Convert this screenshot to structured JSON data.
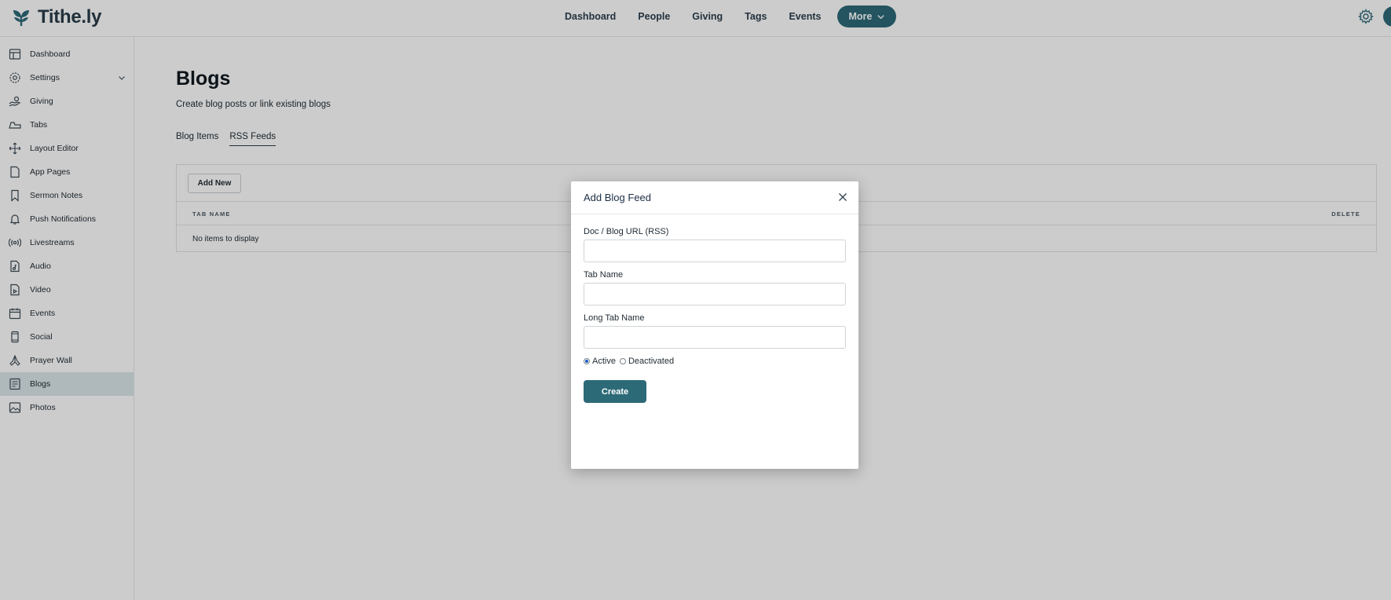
{
  "brand": {
    "name": "Tithe.ly",
    "accent": "#2d6a78"
  },
  "topnav": {
    "items": [
      "Dashboard",
      "People",
      "Giving",
      "Tags",
      "Events"
    ],
    "more_label": "More"
  },
  "sidebar": {
    "items": [
      {
        "label": "Dashboard",
        "icon": "dashboard-icon"
      },
      {
        "label": "Settings",
        "icon": "gear-icon"
      },
      {
        "label": "Giving",
        "icon": "hand-coins-icon"
      },
      {
        "label": "Tabs",
        "icon": "tabs-icon"
      },
      {
        "label": "Layout Editor",
        "icon": "move-icon"
      },
      {
        "label": "App Pages",
        "icon": "page-icon"
      },
      {
        "label": "Sermon Notes",
        "icon": "bookmark-icon"
      },
      {
        "label": "Push Notifications",
        "icon": "bell-icon"
      },
      {
        "label": "Livestreams",
        "icon": "broadcast-icon"
      },
      {
        "label": "Audio",
        "icon": "audio-file-icon"
      },
      {
        "label": "Video",
        "icon": "video-file-icon"
      },
      {
        "label": "Events",
        "icon": "calendar-icon"
      },
      {
        "label": "Social",
        "icon": "phone-icon"
      },
      {
        "label": "Prayer Wall",
        "icon": "praying-hands-icon"
      },
      {
        "label": "Blogs",
        "icon": "blog-icon"
      },
      {
        "label": "Photos",
        "icon": "image-icon"
      }
    ],
    "active": "Blogs"
  },
  "main": {
    "title": "Blogs",
    "subtitle": "Create blog posts or link existing blogs",
    "tabs": [
      "Blog Items",
      "RSS Feeds"
    ],
    "active_tab": "RSS Feeds",
    "add_button": "Add New",
    "table": {
      "columns": [
        "TAB NAME",
        "DELETE"
      ],
      "empty_text": "No items to display"
    }
  },
  "modal": {
    "title": "Add Blog Feed",
    "fields": [
      {
        "label": "Doc / Blog URL (RSS)",
        "value": ""
      },
      {
        "label": "Tab Name",
        "value": ""
      },
      {
        "label": "Long Tab Name",
        "value": ""
      }
    ],
    "status_options": [
      "Active",
      "Deactivated"
    ],
    "status_selected": "Active",
    "submit_label": "Create"
  }
}
